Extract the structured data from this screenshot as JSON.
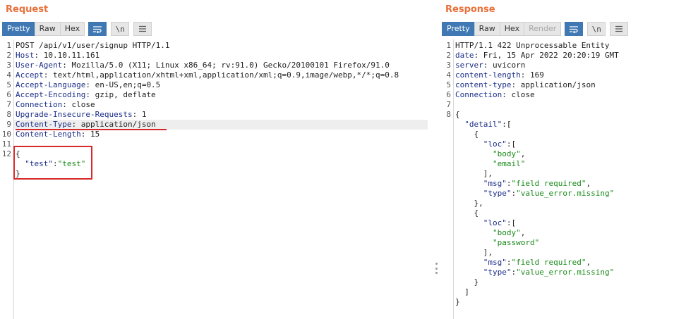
{
  "request": {
    "title": "Request",
    "tabs": [
      "Pretty",
      "Raw",
      "Hex"
    ],
    "active_tab": "Pretty",
    "tools": {
      "wrap_icon": "wrap-lines-icon",
      "newline_label": "\\n",
      "menu_icon": "menu-icon"
    },
    "lines": [
      {
        "n": "1",
        "text": "POST /api/v1/user/signup HTTP/1.1"
      },
      {
        "n": "2",
        "key": "Host",
        "value": " 10.10.11.161"
      },
      {
        "n": "3",
        "key": "User-Agent",
        "value": " Mozilla/5.0 (X11; Linux x86_64; rv:91.0) Gecko/20100101 Firefox/91.0"
      },
      {
        "n": "4",
        "key": "Accept",
        "value": " text/html,application/xhtml+xml,application/xml;q=0.9,image/webp,*/*;q=0.8"
      },
      {
        "n": "5",
        "key": "Accept-Language",
        "value": " en-US,en;q=0.5"
      },
      {
        "n": "6",
        "key": "Accept-Encoding",
        "value": " gzip, deflate"
      },
      {
        "n": "7",
        "key": "Connection",
        "value": " close"
      },
      {
        "n": "8",
        "key": "Upgrade-Insecure-Requests",
        "value": " 1"
      },
      {
        "n": "9",
        "key": "Content-Type",
        "value": " application/json"
      },
      {
        "n": "10",
        "key": "Content-Length",
        "value": " 15"
      },
      {
        "n": "11",
        "text": ""
      },
      {
        "n": "12",
        "text": "{"
      }
    ],
    "body": {
      "key": "\"test\"",
      "colon": ":",
      "value": "\"test\"",
      "close": "}"
    },
    "highlight_color": "#d62828",
    "accent_color": "#3f78b3"
  },
  "response": {
    "title": "Response",
    "tabs": [
      "Pretty",
      "Raw",
      "Hex",
      "Render"
    ],
    "active_tab": "Pretty",
    "tools": {
      "wrap_icon": "wrap-lines-icon",
      "newline_label": "\\n",
      "menu_icon": "menu-icon"
    },
    "lines": [
      {
        "n": "1",
        "text": "HTTP/1.1 422 Unprocessable Entity"
      },
      {
        "n": "2",
        "key": "date",
        "value": " Fri, 15 Apr 2022 20:20:19 GMT"
      },
      {
        "n": "3",
        "key": "server",
        "value": " uvicorn"
      },
      {
        "n": "4",
        "key": "content-length",
        "value": " 169"
      },
      {
        "n": "5",
        "key": "content-type",
        "value": " application/json"
      },
      {
        "n": "6",
        "key": "Connection",
        "value": " close"
      },
      {
        "n": "7",
        "text": ""
      },
      {
        "n": "8",
        "text": "{"
      }
    ],
    "json_lines": [
      {
        "indent": "  ",
        "parts": [
          [
            "k",
            "\"detail\""
          ],
          [
            "p",
            ":["
          ]
        ]
      },
      {
        "indent": "    ",
        "parts": [
          [
            "p",
            "{"
          ]
        ]
      },
      {
        "indent": "      ",
        "parts": [
          [
            "k",
            "\"loc\""
          ],
          [
            "p",
            ":["
          ]
        ]
      },
      {
        "indent": "        ",
        "parts": [
          [
            "s",
            "\"body\""
          ],
          [
            "p",
            ","
          ]
        ]
      },
      {
        "indent": "        ",
        "parts": [
          [
            "s",
            "\"email\""
          ]
        ]
      },
      {
        "indent": "      ",
        "parts": [
          [
            "p",
            "],"
          ]
        ]
      },
      {
        "indent": "      ",
        "parts": [
          [
            "k",
            "\"msg\""
          ],
          [
            "p",
            ":"
          ],
          [
            "s",
            "\"field required\""
          ],
          [
            "p",
            ","
          ]
        ]
      },
      {
        "indent": "      ",
        "parts": [
          [
            "k",
            "\"type\""
          ],
          [
            "p",
            ":"
          ],
          [
            "s",
            "\"value_error.missing\""
          ]
        ]
      },
      {
        "indent": "    ",
        "parts": [
          [
            "p",
            "},"
          ]
        ]
      },
      {
        "indent": "    ",
        "parts": [
          [
            "p",
            "{"
          ]
        ]
      },
      {
        "indent": "      ",
        "parts": [
          [
            "k",
            "\"loc\""
          ],
          [
            "p",
            ":["
          ]
        ]
      },
      {
        "indent": "        ",
        "parts": [
          [
            "s",
            "\"body\""
          ],
          [
            "p",
            ","
          ]
        ]
      },
      {
        "indent": "        ",
        "parts": [
          [
            "s",
            "\"password\""
          ]
        ]
      },
      {
        "indent": "      ",
        "parts": [
          [
            "p",
            "],"
          ]
        ]
      },
      {
        "indent": "      ",
        "parts": [
          [
            "k",
            "\"msg\""
          ],
          [
            "p",
            ":"
          ],
          [
            "s",
            "\"field required\""
          ],
          [
            "p",
            ","
          ]
        ]
      },
      {
        "indent": "      ",
        "parts": [
          [
            "k",
            "\"type\""
          ],
          [
            "p",
            ":"
          ],
          [
            "s",
            "\"value_error.missing\""
          ]
        ]
      },
      {
        "indent": "    ",
        "parts": [
          [
            "p",
            "}"
          ]
        ]
      },
      {
        "indent": "  ",
        "parts": [
          [
            "p",
            "]"
          ]
        ]
      },
      {
        "indent": "",
        "parts": [
          [
            "p",
            "}"
          ]
        ]
      }
    ]
  }
}
